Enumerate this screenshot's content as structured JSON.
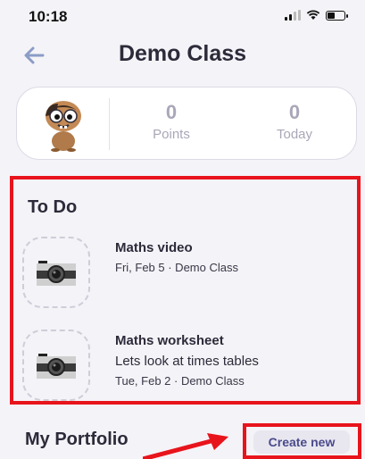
{
  "status_bar": {
    "time": "10:18"
  },
  "header": {
    "title": "Demo Class"
  },
  "stats": {
    "points": {
      "value": "0",
      "label": "Points"
    },
    "today": {
      "value": "0",
      "label": "Today"
    }
  },
  "todo": {
    "title": "To Do",
    "items": [
      {
        "name": "Maths video",
        "meta": "Fri, Feb 5 · Demo Class"
      },
      {
        "name": "Maths worksheet",
        "description": "Lets look at times tables",
        "meta": "Tue, Feb 2 · Demo Class"
      }
    ]
  },
  "portfolio": {
    "title": "My Portfolio",
    "create_label": "Create new"
  },
  "colors": {
    "highlight": "#e8141c",
    "accent": "#4a4a8a",
    "back_arrow": "#8b9cc6"
  },
  "icons": [
    "back-arrow-icon",
    "camera-icon",
    "signal-icon",
    "wifi-icon",
    "battery-icon",
    "monster-avatar"
  ]
}
